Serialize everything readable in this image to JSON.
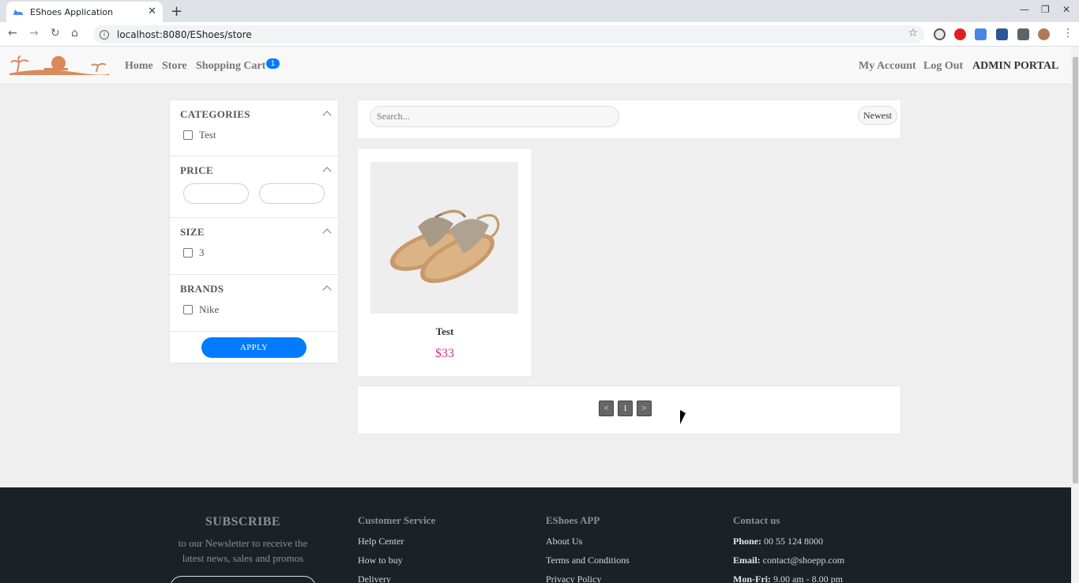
{
  "browser": {
    "tab_title": "EShoes Application",
    "new_tab": "+",
    "close_tab": "✕",
    "url": "localhost:8080/EShoes/store",
    "window_controls": [
      "—",
      "❐",
      "✕"
    ]
  },
  "header": {
    "nav": {
      "home": "Home",
      "store": "Store",
      "cart": "Shopping Cart",
      "cart_count": "1"
    },
    "right": {
      "account": "My Account",
      "logout": "Log Out",
      "admin": "ADMIN PORTAL"
    }
  },
  "filters": {
    "categories": {
      "title": "CATEGORIES",
      "items": [
        "Test"
      ]
    },
    "price": {
      "title": "PRICE",
      "min_value": "",
      "max_value": ""
    },
    "size": {
      "title": "SIZE",
      "items": [
        "3"
      ]
    },
    "brands": {
      "title": "BRANDS",
      "items": [
        "Nike"
      ]
    },
    "apply_label": "APPLY"
  },
  "search": {
    "placeholder": "Search...",
    "sort_label": "Newest"
  },
  "products": [
    {
      "name": "Test",
      "price": "$33",
      "image": "sandal-image"
    }
  ],
  "pagination": {
    "prev": "<",
    "current": "1",
    "next": ">"
  },
  "footer": {
    "subscribe": {
      "title": "SUBSCRIBE",
      "text": "to our Newsletter to receive the latest news, sales and promos"
    },
    "customer_service": {
      "title": "Customer Service",
      "links": [
        "Help Center",
        "How to buy",
        "Delivery"
      ]
    },
    "app": {
      "title": "EShoes APP",
      "links": [
        "About Us",
        "Terms and Conditions",
        "Privacy Policy"
      ]
    },
    "contact": {
      "title": "Contact us",
      "phone_label": "Phone:",
      "phone": "00 55 124 8000",
      "email_label": "Email:",
      "email": "contact@shoepp.com",
      "hours_label": "Mon-Fri:",
      "hours": "9.00 am - 8.00 pm"
    }
  },
  "colors": {
    "accent": "#007bff",
    "price": "#d63384",
    "footer_bg": "#1a2228"
  }
}
